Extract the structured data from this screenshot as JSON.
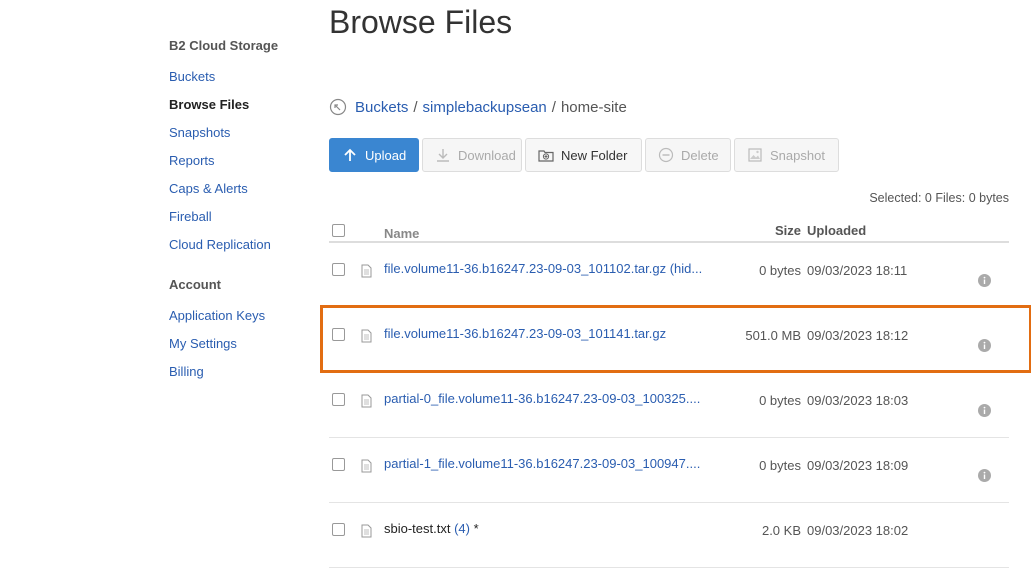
{
  "sidebar": {
    "section1": "B2 Cloud Storage",
    "items1": [
      "Buckets",
      "Browse Files",
      "Snapshots",
      "Reports",
      "Caps & Alerts",
      "Fireball",
      "Cloud Replication"
    ],
    "section2": "Account",
    "items2": [
      "Application Keys",
      "My Settings",
      "Billing"
    ],
    "active": "Browse Files"
  },
  "page": {
    "title": "Browse Files"
  },
  "breadcrumb": {
    "root": "Buckets",
    "bucket": "simplebackupsean",
    "sep": "/",
    "current": "home-site",
    "up_icon": "folder-up-icon"
  },
  "toolbar": {
    "upload": "Upload",
    "download": "Download",
    "new_folder": "New Folder",
    "delete": "Delete",
    "snapshot": "Snapshot"
  },
  "selection": {
    "text": "Selected: 0 Files: 0 bytes"
  },
  "table": {
    "headers": {
      "name": "Name",
      "size": "Size",
      "uploaded": "Uploaded"
    },
    "rows": [
      {
        "name": "file.volume11-36.b16247.23-09-03_101102.tar.gz (hid...",
        "size": "0 bytes",
        "uploaded": "09/03/2023 18:11"
      },
      {
        "name": "file.volume11-36.b16247.23-09-03_101141.tar.gz",
        "size": "501.0 MB",
        "uploaded": "09/03/2023 18:12"
      },
      {
        "name": "partial-0_file.volume11-36.b16247.23-09-03_100325....",
        "size": "0 bytes",
        "uploaded": "09/03/2023 18:03"
      },
      {
        "name": "partial-1_file.volume11-36.b16247.23-09-03_100947....",
        "size": "0 bytes",
        "uploaded": "09/03/2023 18:09"
      },
      {
        "name": "sbio-test.txt",
        "count": "(4)",
        "suffix": " *",
        "size": "2.0 KB",
        "uploaded": "09/03/2023 18:02"
      }
    ]
  },
  "colors": {
    "primary": "#3a86d1",
    "link": "#2a5db0",
    "highlight": "#e26d12"
  }
}
